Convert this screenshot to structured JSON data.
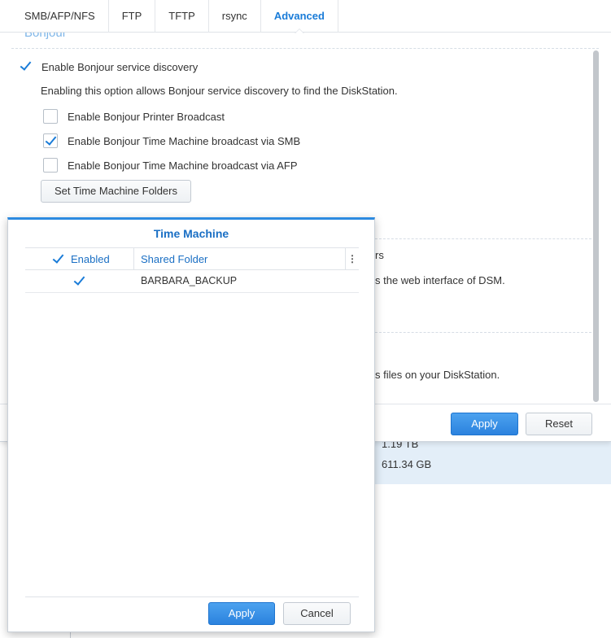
{
  "tabs": [
    {
      "label": "SMB/AFP/NFS",
      "active": false
    },
    {
      "label": "FTP",
      "active": false
    },
    {
      "label": "TFTP",
      "active": false
    },
    {
      "label": "rsync",
      "active": false
    },
    {
      "label": "Advanced",
      "active": true
    }
  ],
  "section_title": "Bonjour",
  "bonjour": {
    "enable_label": "Enable Bonjour service discovery",
    "enable_checked": true,
    "description": "Enabling this option allows Bonjour service discovery to find the DiskStation.",
    "printer_label": "Enable Bonjour Printer Broadcast",
    "printer_checked": false,
    "tm_smb_label": "Enable Bonjour Time Machine broadcast via SMB",
    "tm_smb_checked": true,
    "tm_afp_label": "Enable Bonjour Time Machine broadcast via AFP",
    "tm_afp_checked": false,
    "set_tm_button": "Set Time Machine Folders"
  },
  "partial_text": {
    "line1": "rs",
    "line2": "s the web interface of DSM.",
    "line3": "s files on your DiskStation."
  },
  "window_buttons": {
    "apply": "Apply",
    "reset": "Reset"
  },
  "background_values": {
    "v1": "1.19 TB",
    "v2": "611.34 GB"
  },
  "dialog": {
    "title": "Time Machine",
    "columns": {
      "enabled": "Enabled",
      "shared_folder": "Shared Folder",
      "menu": "⋮"
    },
    "header_checked": true,
    "rows": [
      {
        "enabled": true,
        "shared_folder": "BARBARA_BACKUP"
      }
    ],
    "apply": "Apply",
    "cancel": "Cancel"
  },
  "colors": {
    "accent": "#1a7cd8",
    "primary_button": "#2b82de",
    "highlight_row": "#e3eef8"
  }
}
